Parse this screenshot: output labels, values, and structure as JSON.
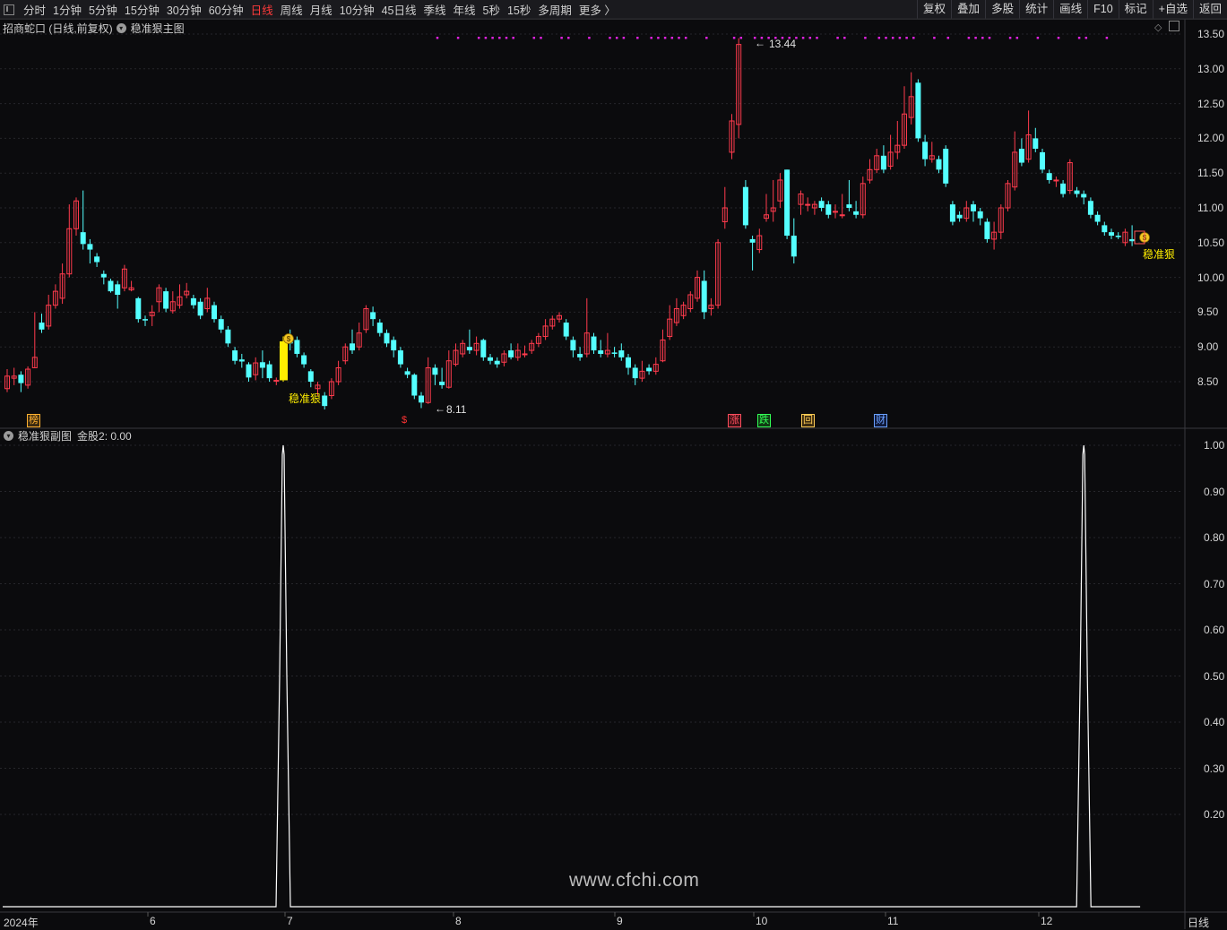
{
  "toolbar": {
    "periods": [
      "分时",
      "1分钟",
      "5分钟",
      "15分钟",
      "30分钟",
      "60分钟",
      "日线",
      "周线",
      "月线",
      "10分钟",
      "45日线",
      "季线",
      "年线",
      "5秒",
      "15秒",
      "多周期",
      "更多 〉"
    ],
    "active_period": "日线",
    "right_buttons": [
      "复权",
      "叠加",
      "多股",
      "统计",
      "画线",
      "F10",
      "标记",
      "+自选",
      "返回"
    ]
  },
  "main_panel": {
    "stock_title": "招商蛇口 (日线,前复权)",
    "indicator_name": "稳准狠主图",
    "y_ticks": [
      "13.50",
      "13.00",
      "12.50",
      "12.00",
      "11.50",
      "11.00",
      "10.50",
      "10.00",
      "9.50",
      "9.00",
      "8.50"
    ],
    "high_label": "13.44",
    "low_label": "8.11",
    "signal_text_1": "稳准狠",
    "signal_text_2": "稳准狠",
    "event_markers": [
      "榜",
      "$",
      "涨",
      "跌",
      "回",
      "财"
    ]
  },
  "sub_panel": {
    "indicator_name": "稳准狠副图",
    "value_text": "金股2: 0.00",
    "y_ticks": [
      "1.00",
      "0.90",
      "0.80",
      "0.70",
      "0.60",
      "0.50",
      "0.40",
      "0.30",
      "0.20"
    ]
  },
  "x_axis": {
    "labels": [
      "2024年",
      "6",
      "7",
      "8",
      "9",
      "10",
      "11",
      "12"
    ],
    "period_label": "日线"
  },
  "watermark": "www.cfchi.com",
  "colors": {
    "up": "#ff3b4d",
    "down": "#54ffff",
    "signal": "#ffee00",
    "magenta": "#dd22dd",
    "background": "#0b0b0d"
  },
  "chart_data": {
    "type": "candlestick",
    "ylim": [
      8.0,
      13.6
    ],
    "candles": [
      [
        8.4,
        8.58,
        8.68,
        8.35
      ],
      [
        8.55,
        8.58,
        8.7,
        8.45
      ],
      [
        8.6,
        8.48,
        8.65,
        8.35
      ],
      [
        8.45,
        8.68,
        8.72,
        8.4
      ],
      [
        8.7,
        8.85,
        9.5,
        8.7
      ],
      [
        9.35,
        9.25,
        9.48,
        9.2
      ],
      [
        9.3,
        9.6,
        9.75,
        9.25
      ],
      [
        9.6,
        9.8,
        9.9,
        9.55
      ],
      [
        9.7,
        10.05,
        10.2,
        9.62
      ],
      [
        10.05,
        10.7,
        11.05,
        10.0
      ],
      [
        10.7,
        11.1,
        11.15,
        10.6
      ],
      [
        10.65,
        10.48,
        11.25,
        10.4
      ],
      [
        10.48,
        10.4,
        10.55,
        10.2
      ],
      [
        10.3,
        10.22,
        10.35,
        10.15
      ],
      [
        10.05,
        10.0,
        10.1,
        9.9
      ],
      [
        9.95,
        9.8,
        9.98,
        9.78
      ],
      [
        9.9,
        9.75,
        9.95,
        9.55
      ],
      [
        9.85,
        10.12,
        10.18,
        9.8
      ],
      [
        9.82,
        9.85,
        9.95,
        9.8
      ],
      [
        9.7,
        9.4,
        9.72,
        9.35
      ],
      [
        9.4,
        9.38,
        9.45,
        9.3
      ],
      [
        9.45,
        9.5,
        9.6,
        9.3
      ],
      [
        9.65,
        9.85,
        9.9,
        9.5
      ],
      [
        9.8,
        9.55,
        9.85,
        9.5
      ],
      [
        9.52,
        9.65,
        9.8,
        9.48
      ],
      [
        9.6,
        9.72,
        9.9,
        9.55
      ],
      [
        9.75,
        9.8,
        9.92,
        9.7
      ],
      [
        9.7,
        9.6,
        9.75,
        9.55
      ],
      [
        9.65,
        9.45,
        9.7,
        9.4
      ],
      [
        9.55,
        9.7,
        9.85,
        9.5
      ],
      [
        9.6,
        9.4,
        9.65,
        9.35
      ],
      [
        9.4,
        9.25,
        9.45,
        9.2
      ],
      [
        9.25,
        9.05,
        9.3,
        9.0
      ],
      [
        8.95,
        8.8,
        9.0,
        8.75
      ],
      [
        8.82,
        8.79,
        8.9,
        8.7
      ],
      [
        8.75,
        8.56,
        8.78,
        8.5
      ],
      [
        8.6,
        8.77,
        8.85,
        8.52
      ],
      [
        8.78,
        8.7,
        8.95,
        8.55
      ],
      [
        8.75,
        8.55,
        8.8,
        8.5
      ],
      [
        8.52,
        8.52,
        8.56,
        8.45
      ],
      [
        8.52,
        9.08,
        9.15,
        8.5
      ],
      [
        9.1,
        9.05,
        9.25,
        8.95
      ],
      [
        9.1,
        8.9,
        9.15,
        8.85
      ],
      [
        8.88,
        8.75,
        8.92,
        8.7
      ],
      [
        8.65,
        8.5,
        8.68,
        8.42
      ],
      [
        8.4,
        8.45,
        8.5,
        8.3
      ],
      [
        8.3,
        8.15,
        8.35,
        8.1
      ],
      [
        8.3,
        8.5,
        8.55,
        8.25
      ],
      [
        8.5,
        8.7,
        8.8,
        8.45
      ],
      [
        8.8,
        9.0,
        9.05,
        8.75
      ],
      [
        9.05,
        8.95,
        9.25,
        8.9
      ],
      [
        9.0,
        9.2,
        9.35,
        8.95
      ],
      [
        9.25,
        9.55,
        9.6,
        9.2
      ],
      [
        9.5,
        9.4,
        9.58,
        9.3
      ],
      [
        9.35,
        9.2,
        9.4,
        9.15
      ],
      [
        9.2,
        9.05,
        9.25,
        9.0
      ],
      [
        9.1,
        8.95,
        9.15,
        8.85
      ],
      [
        8.95,
        8.75,
        9.0,
        8.7
      ],
      [
        8.65,
        8.6,
        8.7,
        8.55
      ],
      [
        8.6,
        8.3,
        8.62,
        8.25
      ],
      [
        8.3,
        8.2,
        8.35,
        8.12
      ],
      [
        8.2,
        8.7,
        8.85,
        8.18
      ],
      [
        8.7,
        8.6,
        8.75,
        8.45
      ],
      [
        8.5,
        8.45,
        8.7,
        8.4
      ],
      [
        8.42,
        8.8,
        8.95,
        8.4
      ],
      [
        8.75,
        8.95,
        9.05,
        8.72
      ],
      [
        8.9,
        9.05,
        9.1,
        8.85
      ],
      [
        9.0,
        8.95,
        9.25,
        8.9
      ],
      [
        8.95,
        9.05,
        9.15,
        8.88
      ],
      [
        9.1,
        8.85,
        9.12,
        8.8
      ],
      [
        8.85,
        8.8,
        8.9,
        8.75
      ],
      [
        8.8,
        8.75,
        8.85,
        8.7
      ],
      [
        8.78,
        8.9,
        8.95,
        8.72
      ],
      [
        8.95,
        8.85,
        9.05,
        8.82
      ],
      [
        8.85,
        8.95,
        9.05,
        8.8
      ],
      [
        8.9,
        8.9,
        9.02,
        8.85
      ],
      [
        8.95,
        9.05,
        9.1,
        8.9
      ],
      [
        9.05,
        9.15,
        9.2,
        9.0
      ],
      [
        9.15,
        9.3,
        9.4,
        9.1
      ],
      [
        9.3,
        9.4,
        9.45,
        9.25
      ],
      [
        9.4,
        9.45,
        9.5,
        9.35
      ],
      [
        9.35,
        9.15,
        9.4,
        9.1
      ],
      [
        9.1,
        8.95,
        9.15,
        8.85
      ],
      [
        8.9,
        8.85,
        9.0,
        8.8
      ],
      [
        8.9,
        9.2,
        9.7,
        8.85
      ],
      [
        9.15,
        8.95,
        9.2,
        8.9
      ],
      [
        8.95,
        8.9,
        9.1,
        8.85
      ],
      [
        8.9,
        8.95,
        9.2,
        8.85
      ],
      [
        8.92,
        8.9,
        9.0,
        8.85
      ],
      [
        8.95,
        8.85,
        9.05,
        8.8
      ],
      [
        8.85,
        8.7,
        8.9,
        8.6
      ],
      [
        8.7,
        8.55,
        8.75,
        8.45
      ],
      [
        8.55,
        8.65,
        8.8,
        8.5
      ],
      [
        8.7,
        8.65,
        8.75,
        8.6
      ],
      [
        8.65,
        8.75,
        8.85,
        8.6
      ],
      [
        8.8,
        9.1,
        9.25,
        8.78
      ],
      [
        9.15,
        9.4,
        9.6,
        9.1
      ],
      [
        9.35,
        9.55,
        9.7,
        9.3
      ],
      [
        9.45,
        9.6,
        9.65,
        9.4
      ],
      [
        9.55,
        9.75,
        9.8,
        9.5
      ],
      [
        9.7,
        10.0,
        10.1,
        9.65
      ],
      [
        9.95,
        9.5,
        10.1,
        9.4
      ],
      [
        9.55,
        9.6,
        9.7,
        9.45
      ],
      [
        9.6,
        10.5,
        10.55,
        9.55
      ],
      [
        10.8,
        11.0,
        11.3,
        10.7
      ],
      [
        11.8,
        12.25,
        12.35,
        11.7
      ],
      [
        12.2,
        13.35,
        13.44,
        12.0
      ],
      [
        11.3,
        10.75,
        11.4,
        10.7
      ],
      [
        10.55,
        10.5,
        10.6,
        10.1
      ],
      [
        10.4,
        10.6,
        10.7,
        10.35
      ],
      [
        10.85,
        10.9,
        11.2,
        10.8
      ],
      [
        10.95,
        11.0,
        11.4,
        10.8
      ],
      [
        11.1,
        11.4,
        11.5,
        11.0
      ],
      [
        11.55,
        10.6,
        11.55,
        10.55
      ],
      [
        10.6,
        10.3,
        10.85,
        10.2
      ],
      [
        11.05,
        11.2,
        11.25,
        10.9
      ],
      [
        11.05,
        11.05,
        11.15,
        10.95
      ],
      [
        11.0,
        11.05,
        11.1,
        10.9
      ],
      [
        11.1,
        11.0,
        11.15,
        10.95
      ],
      [
        11.05,
        10.9,
        11.1,
        10.85
      ],
      [
        10.95,
        10.95,
        11.05,
        10.85
      ],
      [
        10.9,
        10.9,
        11.2,
        10.85
      ],
      [
        11.05,
        11.0,
        11.4,
        10.95
      ],
      [
        10.95,
        10.9,
        11.1,
        10.85
      ],
      [
        10.9,
        11.35,
        11.45,
        10.85
      ],
      [
        11.4,
        11.55,
        11.7,
        11.35
      ],
      [
        11.55,
        11.75,
        11.85,
        11.5
      ],
      [
        11.75,
        11.55,
        11.9,
        11.5
      ],
      [
        11.6,
        11.8,
        12.05,
        11.55
      ],
      [
        11.8,
        11.9,
        12.25,
        11.7
      ],
      [
        11.9,
        12.35,
        12.75,
        11.85
      ],
      [
        12.3,
        12.6,
        12.95,
        12.2
      ],
      [
        12.8,
        12.0,
        12.85,
        11.95
      ],
      [
        11.95,
        11.7,
        12.05,
        11.6
      ],
      [
        11.7,
        11.75,
        11.95,
        11.65
      ],
      [
        11.7,
        11.55,
        11.75,
        11.5
      ],
      [
        11.85,
        11.35,
        11.9,
        11.3
      ],
      [
        11.05,
        10.8,
        11.1,
        10.75
      ],
      [
        10.9,
        10.85,
        10.95,
        10.8
      ],
      [
        10.85,
        11.0,
        11.1,
        10.8
      ],
      [
        11.05,
        10.95,
        11.1,
        10.8
      ],
      [
        10.95,
        10.85,
        11.0,
        10.75
      ],
      [
        10.8,
        10.55,
        10.85,
        10.5
      ],
      [
        10.55,
        10.65,
        10.8,
        10.4
      ],
      [
        10.65,
        11.0,
        11.05,
        10.55
      ],
      [
        11.0,
        11.35,
        11.4,
        10.95
      ],
      [
        11.3,
        11.8,
        12.1,
        11.25
      ],
      [
        11.85,
        11.65,
        12.0,
        11.6
      ],
      [
        11.7,
        12.05,
        12.4,
        11.65
      ],
      [
        12.0,
        11.85,
        12.15,
        11.8
      ],
      [
        11.8,
        11.55,
        11.85,
        11.5
      ],
      [
        11.5,
        11.4,
        11.55,
        11.35
      ],
      [
        11.4,
        11.4,
        11.45,
        11.3
      ],
      [
        11.35,
        11.2,
        11.4,
        11.15
      ],
      [
        11.25,
        11.65,
        11.7,
        11.2
      ],
      [
        11.25,
        11.2,
        11.3,
        11.15
      ],
      [
        11.2,
        11.15,
        11.25,
        11.05
      ],
      [
        11.1,
        10.9,
        11.15,
        10.85
      ],
      [
        10.9,
        10.8,
        10.95,
        10.75
      ],
      [
        10.75,
        10.65,
        10.8,
        10.6
      ],
      [
        10.65,
        10.6,
        10.7,
        10.55
      ],
      [
        10.6,
        10.58,
        10.65,
        10.55
      ],
      [
        10.5,
        10.65,
        10.7,
        10.45
      ],
      [
        10.55,
        10.52,
        10.75,
        10.45
      ]
    ],
    "top_magenta_dots_present": true,
    "sub_series": {
      "name": "金股2",
      "spikes_at_candle": [
        40,
        156
      ],
      "baseline": 0,
      "peak": 1.0,
      "ylim": [
        0,
        1.05
      ]
    }
  }
}
